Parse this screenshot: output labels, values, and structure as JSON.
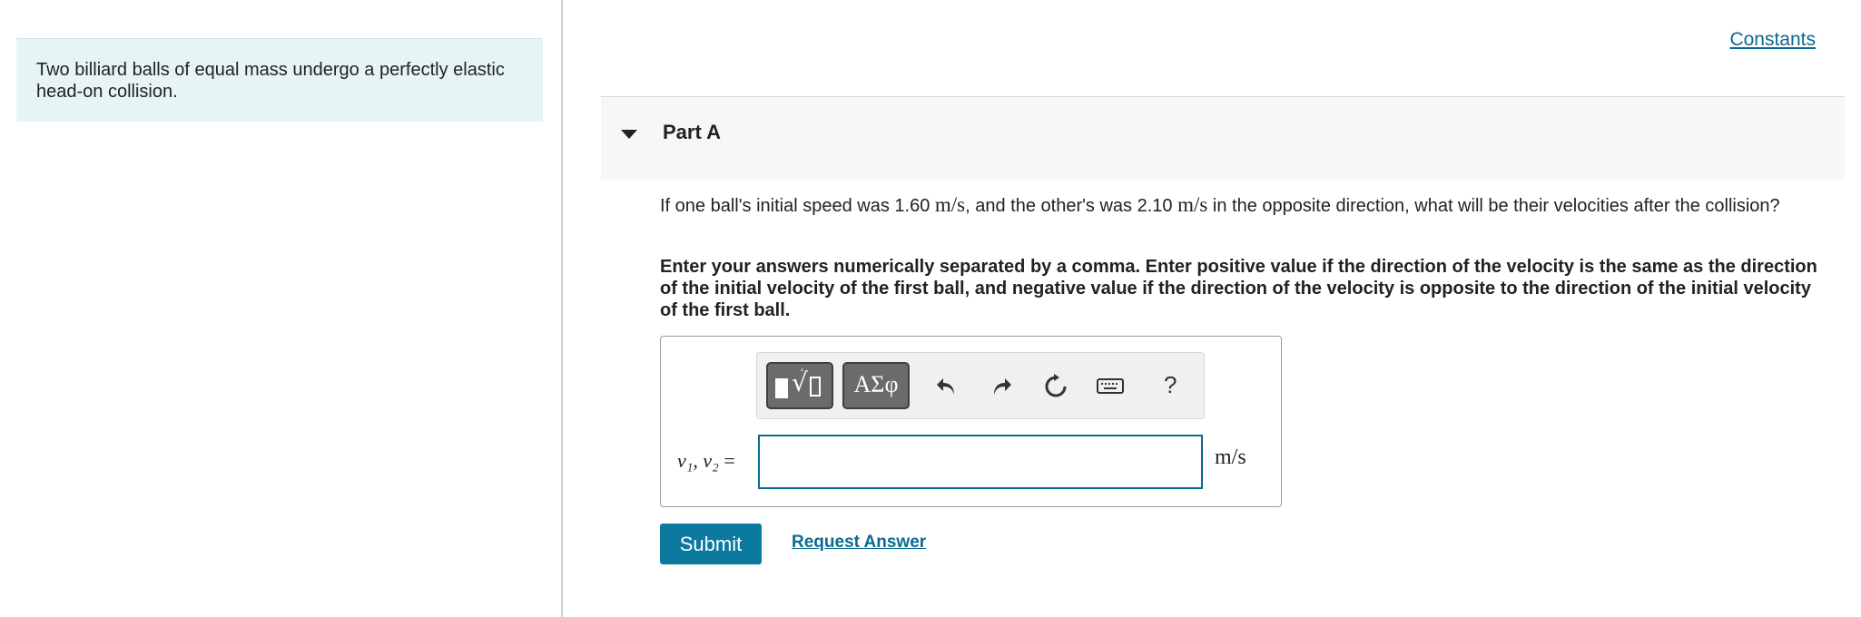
{
  "problem": {
    "text": "Two billiard balls of equal mass undergo a perfectly elastic head-on collision."
  },
  "header": {
    "constants_link": "Constants"
  },
  "part": {
    "title": "Part A",
    "question": {
      "before_1": "If one ball's initial speed was 1.60 ",
      "unit_1": "m/s",
      "middle": ", and the other's was 2.10 ",
      "unit_2": "m/s",
      "after": " in the opposite direction, what will be their velocities after the collision?"
    },
    "instructions": "Enter your answers numerically separated by a comma. Enter positive value if the direction of the velocity is the same as the direction of the initial velocity of the first ball, and negative value if the direction of the velocity is opposite to the direction of the initial velocity of the first ball."
  },
  "answer": {
    "variable_label": "v₁, v₂",
    "equals": "=",
    "input_value": "",
    "unit": "m/s"
  },
  "toolbar": {
    "templates_icon": "templates-icon",
    "symbols_label": "ΑΣφ",
    "undo_icon": "undo-icon",
    "redo_icon": "redo-icon",
    "reset_icon": "reset-icon",
    "keyboard_icon": "keyboard-icon",
    "help_label": "?"
  },
  "actions": {
    "submit_label": "Submit",
    "request_answer_label": "Request Answer"
  },
  "colors": {
    "accent": "#0b7a9e",
    "link": "#0b6a91",
    "problem_bg": "#e6f4f4"
  }
}
